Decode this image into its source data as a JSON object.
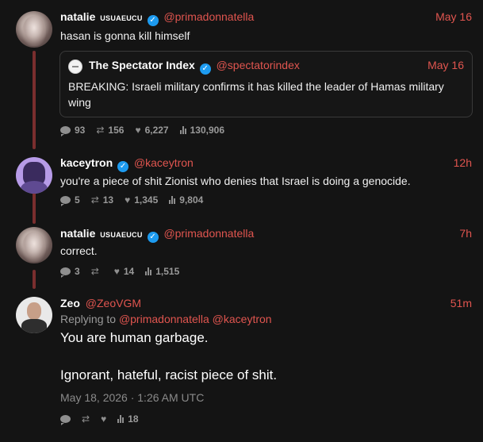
{
  "posts": [
    {
      "name": "natalie",
      "flag": "USUAEUCU",
      "handle": "@primadonnatella",
      "time": "May 16",
      "text": "hasan is gonna kill himself",
      "quote": {
        "name": "The Spectator Index",
        "handle": "@spectatorindex",
        "time": "May 16",
        "text": "BREAKING: Israeli military confirms it has killed the leader of Hamas military wing"
      },
      "stats": {
        "replies": "93",
        "reposts": "156",
        "likes": "6,227",
        "views": "130,906"
      }
    },
    {
      "name": "kaceytron",
      "handle": "@kaceytron",
      "time": "12h",
      "text": "you're a piece of shit Zionist who denies that Israel is doing a genocide.",
      "stats": {
        "replies": "5",
        "reposts": "13",
        "likes": "1,345",
        "views": "9,804"
      }
    },
    {
      "name": "natalie",
      "flag": "USUAEUCU",
      "handle": "@primadonnatella",
      "time": "7h",
      "text": "correct.",
      "stats": {
        "replies": "3",
        "reposts": "",
        "likes": "14",
        "views": "1,515"
      }
    },
    {
      "name": "Zeo",
      "handle": "@ZeoVGM",
      "time": "51m",
      "replying_prefix": "Replying to",
      "replying_to": [
        "@primadonnatella",
        "@kaceytron"
      ],
      "text_line1": "You are human garbage.",
      "text_line2": "Ignorant, hateful, racist piece of shit.",
      "timestamp": "May 18, 2026 · 1:26 AM UTC",
      "stats": {
        "replies": "",
        "reposts": "",
        "likes": "",
        "views": "18"
      }
    }
  ],
  "colors": {
    "background": "#141414",
    "accent": "#e0554f",
    "verified": "#1d9bf0",
    "thread_line": "#7a2e2e"
  },
  "icons": [
    "reply-icon",
    "repost-icon",
    "like-icon",
    "views-icon",
    "verified-icon"
  ]
}
